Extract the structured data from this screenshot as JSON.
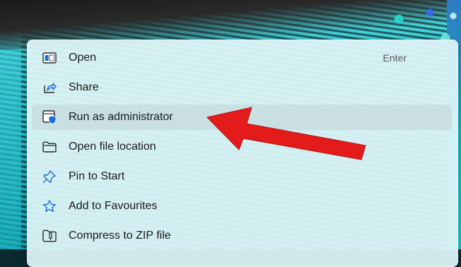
{
  "menu": {
    "items": [
      {
        "label": "Open",
        "shortcut": "Enter",
        "icon": "window-icon"
      },
      {
        "label": "Share",
        "shortcut": "",
        "icon": "share-icon"
      },
      {
        "label": "Run as administrator",
        "shortcut": "",
        "icon": "shield-icon"
      },
      {
        "label": "Open file location",
        "shortcut": "",
        "icon": "folder-icon"
      },
      {
        "label": "Pin to Start",
        "shortcut": "",
        "icon": "pin-icon"
      },
      {
        "label": "Add to Favourites",
        "shortcut": "",
        "icon": "star-icon"
      },
      {
        "label": "Compress to ZIP file",
        "shortcut": "",
        "icon": "zip-icon"
      }
    ],
    "highlighted_item": "Run as administrator"
  },
  "colors": {
    "menu_bg": "#def4f6",
    "highlight_bg": "#c8dee1",
    "text": "#1b1b1b",
    "accent_blue": "#1a6fd6",
    "annotation_arrow": "#e31b1b"
  }
}
